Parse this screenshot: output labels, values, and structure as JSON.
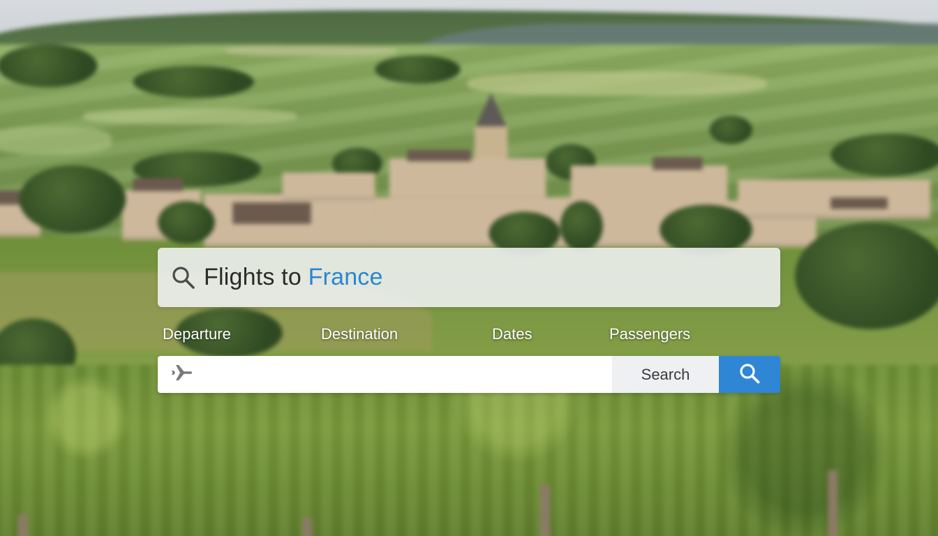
{
  "header": {
    "title_prefix": "Flights to ",
    "title_accent": "France",
    "search_icon": "search-icon",
    "accent_color": "#2a86d1"
  },
  "fields": {
    "departure_label": "Departure",
    "destination_label": "Destination",
    "dates_label": "Dates",
    "passengers_label": "Passengers"
  },
  "search_bar": {
    "input_value": "",
    "input_icon": "airplane-icon",
    "search_button_label": "Search",
    "search_button_icon": "search-icon",
    "button_color": "#2f86d4"
  }
}
